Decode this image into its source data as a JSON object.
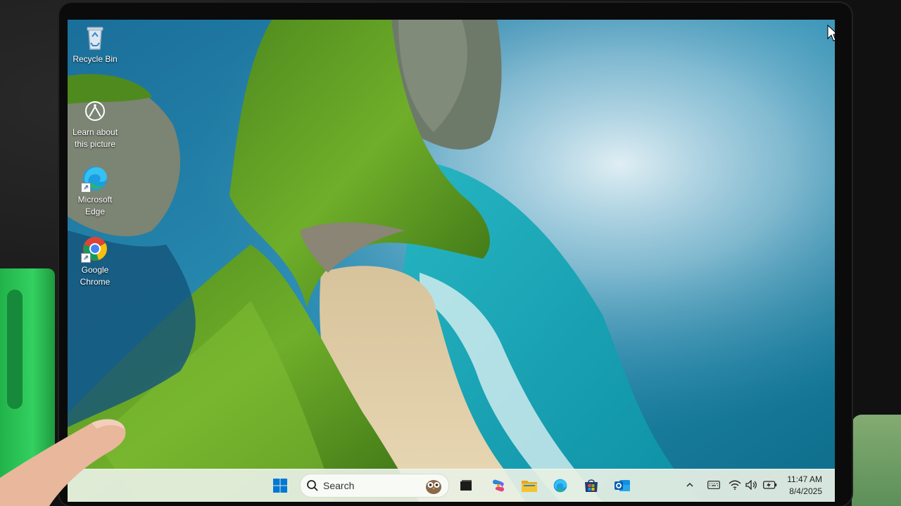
{
  "desktop": {
    "icons": [
      {
        "label": "Recycle Bin",
        "icon": "recycle-bin-icon"
      },
      {
        "label": "Learn about this picture",
        "icon": "learn-about-picture-icon"
      },
      {
        "label": "Microsoft Edge",
        "icon": "edge-icon"
      },
      {
        "label": "Google Chrome",
        "icon": "chrome-icon"
      }
    ]
  },
  "taskbar": {
    "search_placeholder": "Search",
    "pinned": [
      "start-icon",
      "search-icon",
      "task-view-icon",
      "copilot-icon",
      "file-explorer-icon",
      "edge-icon",
      "microsoft-store-icon",
      "outlook-icon"
    ],
    "tray": [
      "chevron-up-icon",
      "keyboard-icon",
      "wifi-icon",
      "volume-icon",
      "battery-icon"
    ],
    "time": "11:47 AM",
    "date": "8/4/2025"
  },
  "colors": {
    "taskbar_bg": "#e8f0e4",
    "windows_blue": "#0078d4",
    "folder_yellow": "#f4c430"
  }
}
